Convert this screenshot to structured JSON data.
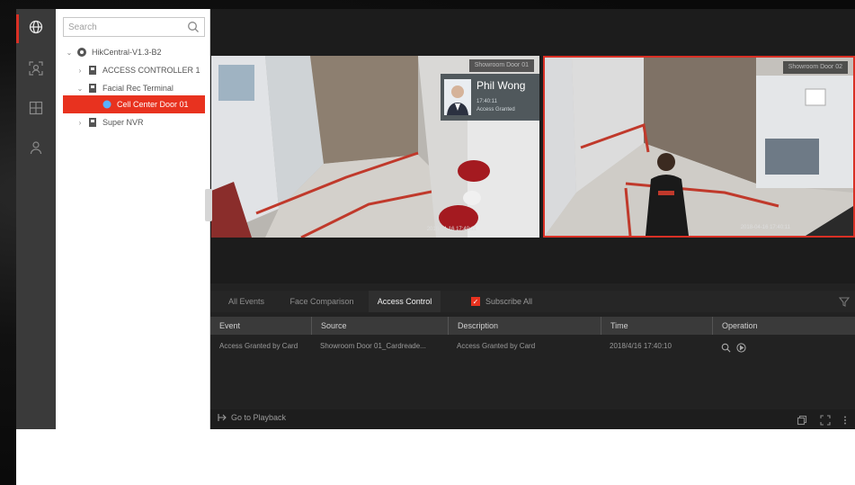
{
  "rail": {
    "items": [
      {
        "name": "globe",
        "active": true
      },
      {
        "name": "face",
        "active": false
      },
      {
        "name": "layout",
        "active": false
      },
      {
        "name": "person",
        "active": false
      }
    ]
  },
  "tree": {
    "search_placeholder": "Search",
    "nodes": [
      {
        "label": "HikCentral-V1.3-B2",
        "level": 0
      },
      {
        "label": "ACCESS CONTROLLER 1",
        "level": 1
      },
      {
        "label": "Facial Rec Terminal",
        "level": 1
      },
      {
        "label": "Cell Center Door 01",
        "level": 2,
        "selected": true
      },
      {
        "label": "Super NVR",
        "level": 1
      }
    ]
  },
  "video": {
    "tiles": [
      {
        "label": "Showroom Door 01",
        "timestamp": "2018-04-16 17:40:11"
      },
      {
        "label": "Showroom Door 02",
        "timestamp": "2018-04-16 17:40:11"
      }
    ],
    "face_card": {
      "name": "Phil Wong",
      "line1": "17:40:11",
      "line2": "Access Granted"
    }
  },
  "events": {
    "tabs": [
      "All Events",
      "Face Comparison",
      "Access Control"
    ],
    "active_tab": "Access Control",
    "subscribe_label": "Subscribe All",
    "columns": [
      "Event",
      "Source",
      "Description",
      "Time",
      "Operation"
    ],
    "rows": [
      {
        "event": "Access Granted by Card",
        "source": "Showroom Door 01_Cardreade...",
        "description": "Access Granted by Card",
        "time": "2018/4/16 17:40:10"
      }
    ],
    "playback_label": "Go to Playback"
  },
  "colors": {
    "accent": "#e8321f",
    "panel": "#232323",
    "rail": "#3a3a3a"
  }
}
